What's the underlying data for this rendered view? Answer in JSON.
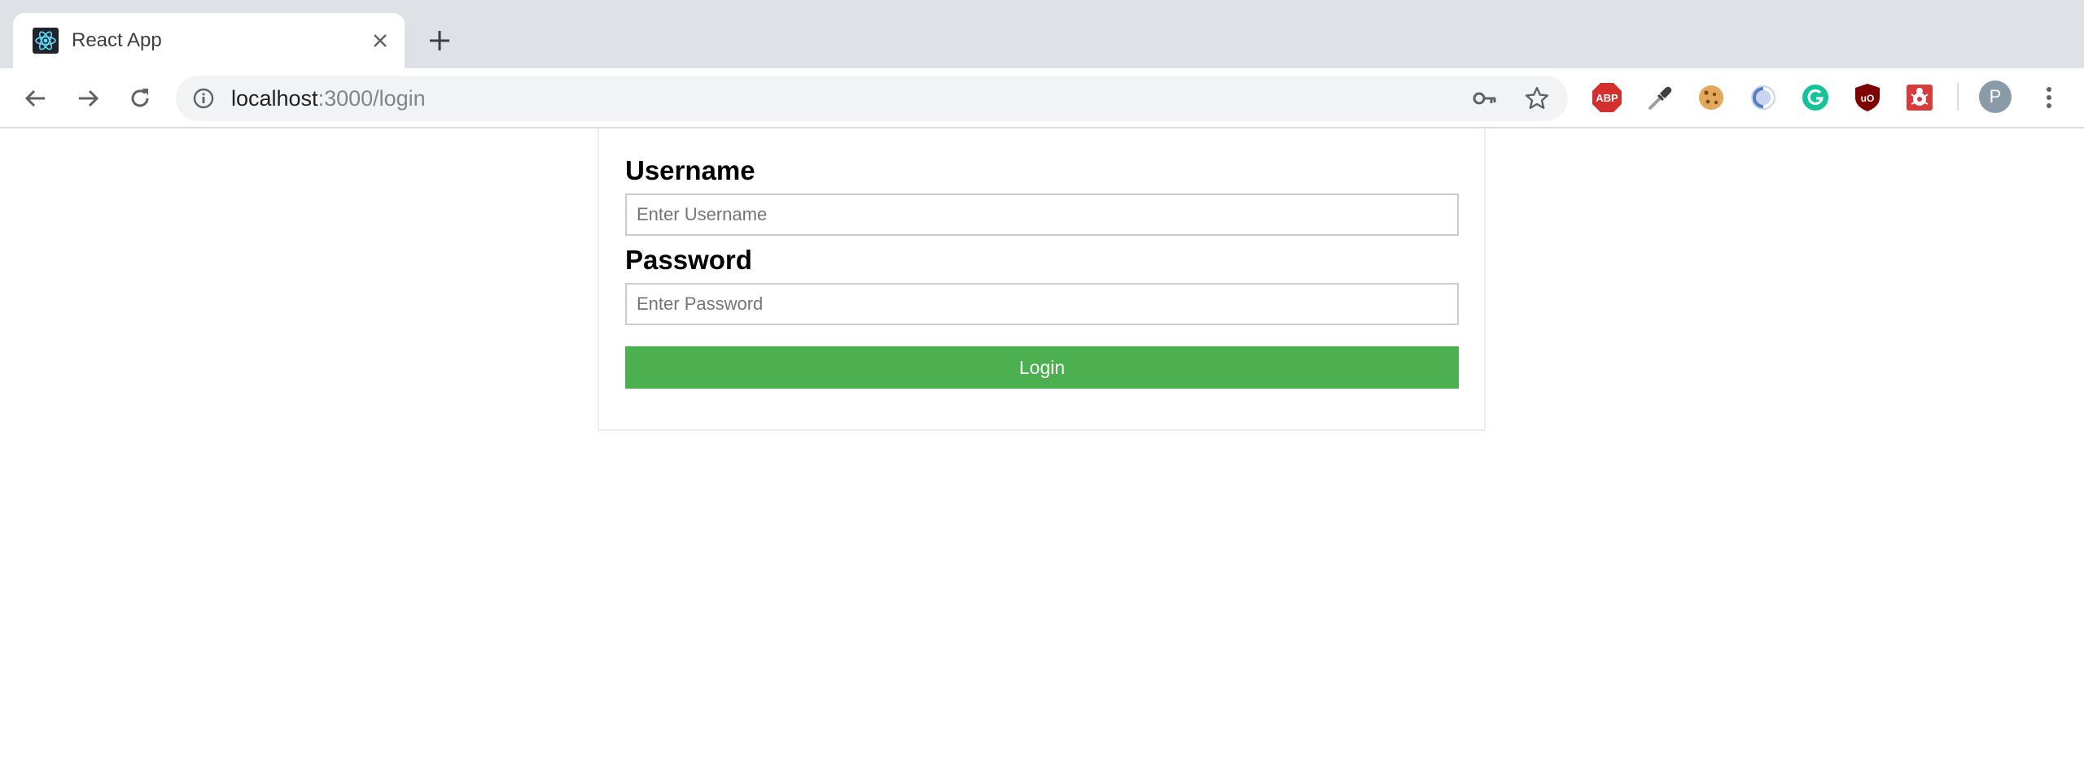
{
  "browser": {
    "tab": {
      "title": "React App",
      "favicon": "react-logo-icon",
      "close_icon": "close-icon"
    },
    "new_tab_icon": "plus-icon",
    "nav": {
      "back_icon": "arrow-left-icon",
      "forward_icon": "arrow-right-icon",
      "reload_icon": "reload-icon"
    },
    "address_bar": {
      "info_icon": "info-icon",
      "host": "localhost",
      "path": ":3000/login",
      "key_icon": "key-icon",
      "bookmark_icon": "star-icon"
    },
    "extensions": [
      {
        "name": "adblock-plus-icon",
        "label": "ABP",
        "color": "#d32f2f"
      },
      {
        "name": "eyedropper-icon",
        "color": "#5f6368"
      },
      {
        "name": "cookie-icon",
        "color": "#d99a4e"
      },
      {
        "name": "extension-ring-icon",
        "color": "#6f8fc6"
      },
      {
        "name": "grammarly-icon",
        "color": "#15c39a"
      },
      {
        "name": "ublock-origin-icon",
        "label": "uO",
        "color": "#800000"
      },
      {
        "name": "react-devtools-bug-icon",
        "color": "#d53c3c"
      }
    ],
    "profile": {
      "initial": "P",
      "color": "#8a9ba8"
    },
    "menu_icon": "three-dots-vertical-icon"
  },
  "login_form": {
    "username_label": "Username",
    "username_placeholder": "Enter Username",
    "username_value": "",
    "password_label": "Password",
    "password_placeholder": "Enter Password",
    "password_value": "",
    "submit_label": "Login",
    "submit_color": "#4caf50"
  }
}
